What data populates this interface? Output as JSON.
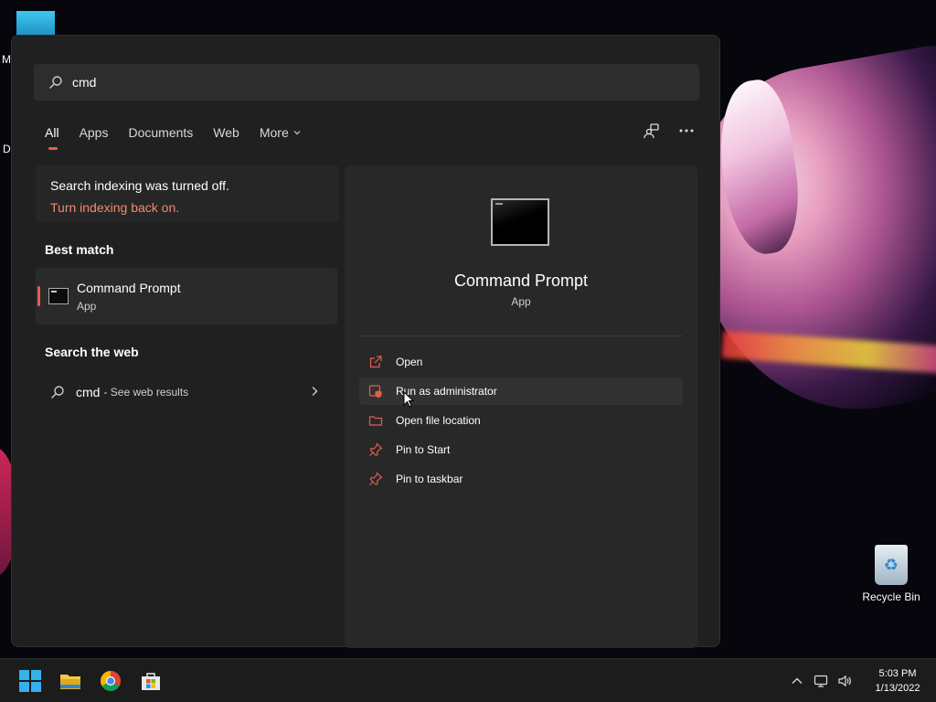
{
  "desktop": {
    "partial_label_m": "M",
    "partial_label_d": "Da",
    "recycle_bin_label": "Recycle Bin"
  },
  "search": {
    "query": "cmd"
  },
  "tabs": [
    {
      "label": "All",
      "active": true
    },
    {
      "label": "Apps"
    },
    {
      "label": "Documents"
    },
    {
      "label": "Web"
    },
    {
      "label": "More"
    }
  ],
  "index_notice": {
    "title": "Search indexing was turned off.",
    "link": "Turn indexing back on."
  },
  "best_match": {
    "heading": "Best match",
    "name": "Command Prompt",
    "type": "App"
  },
  "web": {
    "heading": "Search the web",
    "query": "cmd",
    "suffix": "- See web results"
  },
  "preview": {
    "name": "Command Prompt",
    "type": "App",
    "actions": [
      {
        "label": "Open",
        "icon": "open-external-icon"
      },
      {
        "label": "Run as administrator",
        "icon": "shield-icon"
      },
      {
        "label": "Open file location",
        "icon": "folder-icon"
      },
      {
        "label": "Pin to Start",
        "icon": "pin-icon"
      },
      {
        "label": "Pin to taskbar",
        "icon": "pin-icon"
      }
    ]
  },
  "taskbar": {
    "apps": [
      "windows-start",
      "file-explorer",
      "chrome",
      "microsoft-store"
    ],
    "time": "5:03 PM",
    "date": "1/13/2022"
  },
  "colors": {
    "accent": "#e0614b",
    "link": "#f08a72",
    "panel_bg": "#202020"
  }
}
